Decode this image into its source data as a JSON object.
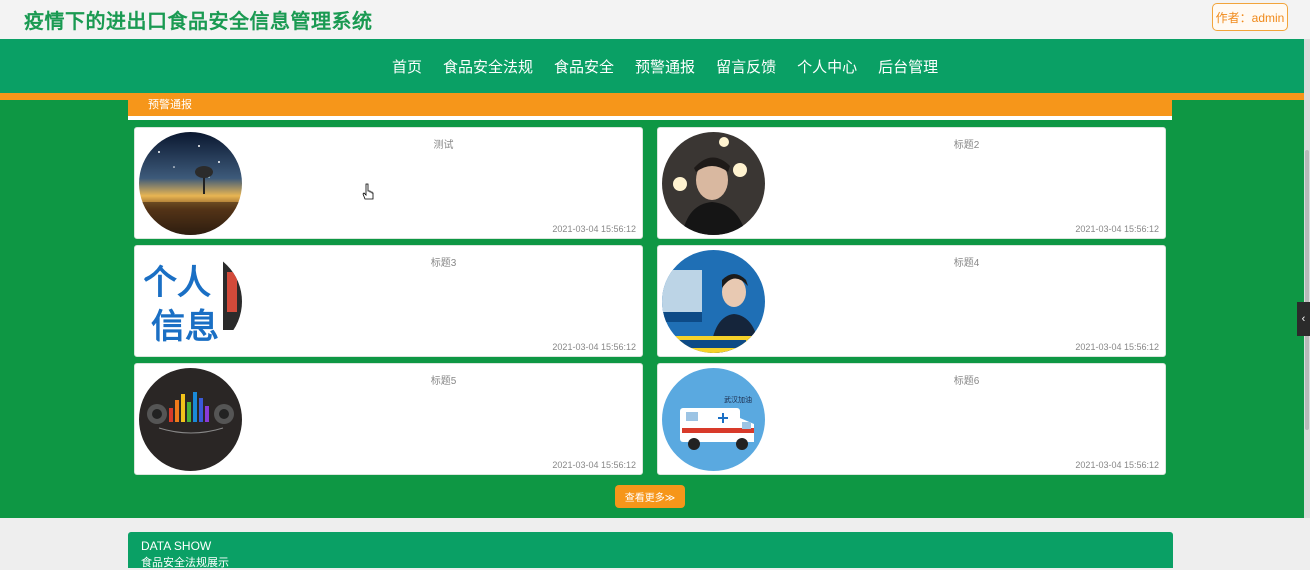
{
  "header": {
    "title": "疫情下的进出口食品安全信息管理系统",
    "author_button": "作者：admin"
  },
  "nav": {
    "items": [
      "首页",
      "食品安全法规",
      "食品安全",
      "预警通报",
      "留言反馈",
      "个人中心",
      "后台管理"
    ]
  },
  "section": {
    "title": "预警通报",
    "more_button": "查看更多≫"
  },
  "cards": [
    {
      "title": "测试",
      "date": "2021-03-04 15:56:12",
      "image": "night-sky-tree"
    },
    {
      "title": "标题2",
      "date": "2021-03-04 15:56:12",
      "image": "man-portrait"
    },
    {
      "title": "标题3",
      "date": "2021-03-04 15:56:12",
      "image": "personal-info-text",
      "image_text": [
        "个人",
        "信息"
      ]
    },
    {
      "title": "标题4",
      "date": "2021-03-04 15:56:12",
      "image": "news-anchor"
    },
    {
      "title": "标题5",
      "date": "2021-03-04 15:56:12",
      "image": "audio-equalizer"
    },
    {
      "title": "标题6",
      "date": "2021-03-04 15:56:12",
      "image": "ambulance",
      "image_text": [
        "武汉加油"
      ]
    }
  ],
  "data_show": {
    "title": "DATA SHOW",
    "subtitle": "食品安全法规展示"
  },
  "side_toggle": "‹",
  "colors": {
    "brand_green": "#0aa065",
    "band_green": "#0e9744",
    "accent_orange": "#f6961a",
    "title_green": "#1a9a52"
  }
}
